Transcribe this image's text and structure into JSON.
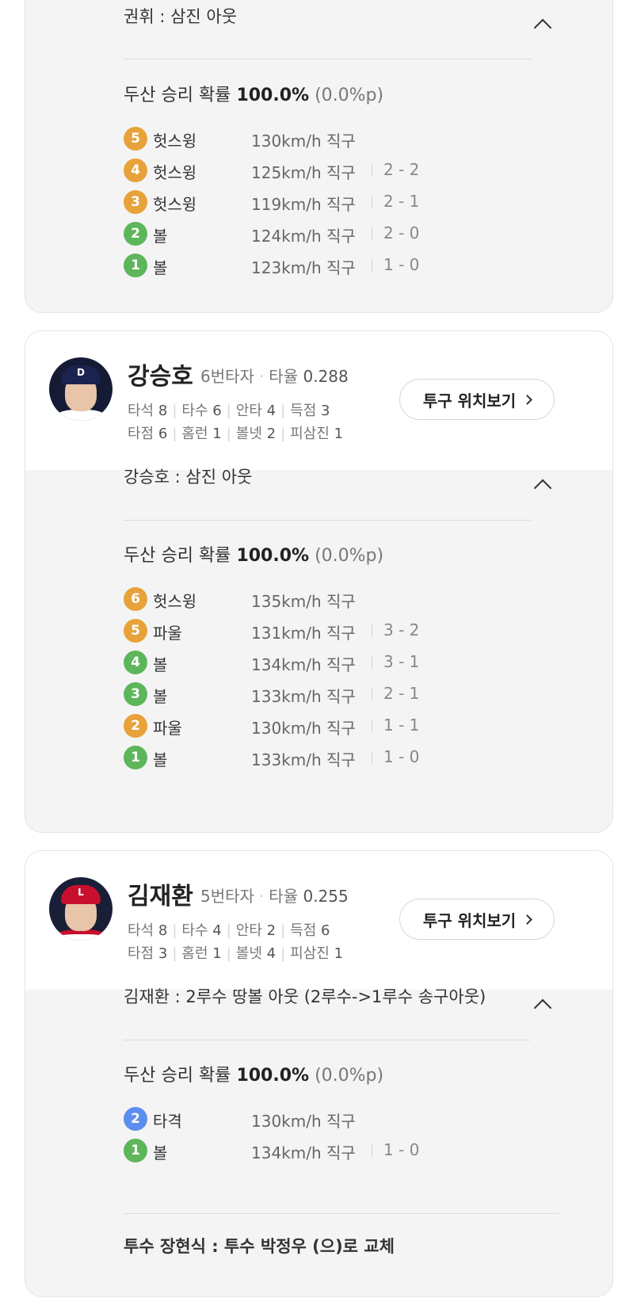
{
  "cards": [
    {
      "id": "card1",
      "result_text": "권휘 : 삼진 아웃",
      "win_prob_label": "두산 승리 확률",
      "win_prob_value": "100.0%",
      "win_prob_delta": "(0.0%p)",
      "pitches": [
        {
          "n": "5",
          "kind": "헛스윙",
          "type": "strike",
          "speed": "130km/h 직구",
          "count": ""
        },
        {
          "n": "4",
          "kind": "헛스윙",
          "type": "strike",
          "speed": "125km/h 직구",
          "count": "2 - 2"
        },
        {
          "n": "3",
          "kind": "헛스윙",
          "type": "strike",
          "speed": "119km/h 직구",
          "count": "2 - 1"
        },
        {
          "n": "2",
          "kind": "볼",
          "type": "ball",
          "speed": "124km/h 직구",
          "count": "2 - 0"
        },
        {
          "n": "1",
          "kind": "볼",
          "type": "ball",
          "speed": "123km/h 직구",
          "count": "1 - 0"
        }
      ]
    },
    {
      "id": "card2",
      "player": {
        "name": "강승호",
        "order": "6번타자",
        "avg_label": "타율",
        "avg": "0.288",
        "stats_row1": [
          {
            "k": "타석",
            "v": "8"
          },
          {
            "k": "타수",
            "v": "6"
          },
          {
            "k": "안타",
            "v": "4"
          },
          {
            "k": "득점",
            "v": "3"
          }
        ],
        "stats_row2": [
          {
            "k": "타점",
            "v": "6"
          },
          {
            "k": "홈런",
            "v": "1"
          },
          {
            "k": "볼넷",
            "v": "2"
          },
          {
            "k": "피삼진",
            "v": "1"
          }
        ],
        "button": "투구 위치보기",
        "team_logo": "D"
      },
      "result_text": "강승호 : 삼진 아웃",
      "win_prob_label": "두산 승리 확률",
      "win_prob_value": "100.0%",
      "win_prob_delta": "(0.0%p)",
      "pitches": [
        {
          "n": "6",
          "kind": "헛스윙",
          "type": "strike",
          "speed": "135km/h 직구",
          "count": ""
        },
        {
          "n": "5",
          "kind": "파울",
          "type": "strike",
          "speed": "131km/h 직구",
          "count": "3 - 2"
        },
        {
          "n": "4",
          "kind": "볼",
          "type": "ball",
          "speed": "134km/h 직구",
          "count": "3 - 1"
        },
        {
          "n": "3",
          "kind": "볼",
          "type": "ball",
          "speed": "133km/h 직구",
          "count": "2 - 1"
        },
        {
          "n": "2",
          "kind": "파울",
          "type": "strike",
          "speed": "130km/h 직구",
          "count": "1 - 1"
        },
        {
          "n": "1",
          "kind": "볼",
          "type": "ball",
          "speed": "133km/h 직구",
          "count": "1 - 0"
        }
      ]
    },
    {
      "id": "card3",
      "player": {
        "name": "김재환",
        "order": "5번타자",
        "avg_label": "타율",
        "avg": "0.255",
        "stats_row1": [
          {
            "k": "타석",
            "v": "8"
          },
          {
            "k": "타수",
            "v": "4"
          },
          {
            "k": "안타",
            "v": "2"
          },
          {
            "k": "득점",
            "v": "6"
          }
        ],
        "stats_row2": [
          {
            "k": "타점",
            "v": "3"
          },
          {
            "k": "홈런",
            "v": "1"
          },
          {
            "k": "볼넷",
            "v": "4"
          },
          {
            "k": "피삼진",
            "v": "1"
          }
        ],
        "button": "투구 위치보기",
        "team_logo": "L"
      },
      "result_text": "김재환 : 2루수 땅볼 아웃 (2루수->1루수 송구아웃)",
      "win_prob_label": "두산 승리 확률",
      "win_prob_value": "100.0%",
      "win_prob_delta": "(0.0%p)",
      "pitches": [
        {
          "n": "2",
          "kind": "타격",
          "type": "hit",
          "speed": "130km/h 직구",
          "count": ""
        },
        {
          "n": "1",
          "kind": "볼",
          "type": "ball",
          "speed": "134km/h 직구",
          "count": "1 - 0"
        }
      ],
      "note": "투수 장현식 : 투수 박정우 (으)로 교체"
    }
  ]
}
